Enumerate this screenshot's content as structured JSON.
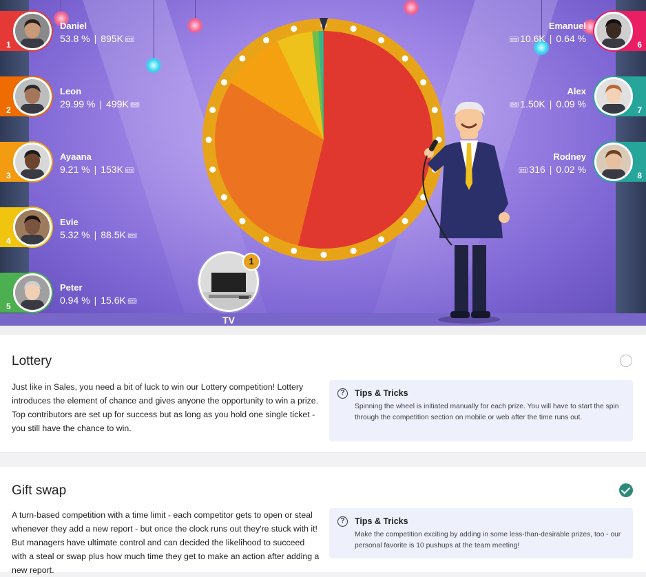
{
  "players_left": [
    {
      "rank": "1",
      "name": "Daniel",
      "percent": "53.8 %",
      "tickets": "895K",
      "color": "#e53935"
    },
    {
      "rank": "2",
      "name": "Leon",
      "percent": "29.99 %",
      "tickets": "499K",
      "color": "#ef6c00"
    },
    {
      "rank": "3",
      "name": "Ayaana",
      "percent": "9.21 %",
      "tickets": "153K",
      "color": "#f39c12"
    },
    {
      "rank": "4",
      "name": "Evie",
      "percent": "5.32 %",
      "tickets": "88.5K",
      "color": "#f1c40f"
    },
    {
      "rank": "5",
      "name": "Peter",
      "percent": "0.94 %",
      "tickets": "15.6K",
      "color": "#4caf50"
    }
  ],
  "players_right": [
    {
      "rank": "6",
      "name": "Emanuel",
      "percent": "0.64 %",
      "tickets": "10.6K",
      "color": "#e91e63"
    },
    {
      "rank": "7",
      "name": "Alex",
      "percent": "0.09 %",
      "tickets": "1.50K",
      "color": "#26a69a"
    },
    {
      "rank": "8",
      "name": "Rodney",
      "percent": "0.02 %",
      "tickets": "316",
      "color": "#26a69a"
    }
  ],
  "prize": {
    "label": "TV",
    "count": "1"
  },
  "wheel": {
    "slices": [
      {
        "name": "Daniel",
        "share": 53.8,
        "color": "#e0382f"
      },
      {
        "name": "Leon",
        "share": 29.99,
        "color": "#ec7420"
      },
      {
        "name": "Ayaana",
        "share": 9.21,
        "color": "#f5a010"
      },
      {
        "name": "Evie",
        "share": 5.32,
        "color": "#eec21a"
      },
      {
        "name": "Peter",
        "share": 0.94,
        "color": "#6cc04a"
      },
      {
        "name": "Emanuel",
        "share": 0.64,
        "color": "#36b58a"
      },
      {
        "name": "Alex",
        "share": 0.09,
        "color": "#2a9a8a"
      },
      {
        "name": "Rodney",
        "share": 0.02,
        "color": "#2a8a9a"
      }
    ],
    "rim_color": "#e8a418"
  },
  "ticket_icon": "ticket-icon",
  "sections": [
    {
      "title": "Lottery",
      "completed": false,
      "description": "Just like in Sales, you need a bit of luck to win our Lottery competition! Lottery introduces the element of chance and gives anyone the opportunity to win a prize. Top contributors are set up for success but as long as you hold one single ticket - you still have the chance to win.",
      "tips_title": "Tips & Tricks",
      "tips_body": "Spinning the wheel is initiated manually for each prize. You will have to start the spin through the competition section on mobile or web after the time runs out."
    },
    {
      "title": "Gift swap",
      "completed": true,
      "description": "A turn-based competition with a time limit - each competitor gets to open or steal whenever they add a new report - but once the clock runs out they're stuck with it! But managers have ultimate control and can decided the likelihood to succeed with a steal or swap plus how much time they get to make an action after adding a new report.",
      "tips_title": "Tips & Tricks",
      "tips_body": "Make the competition exciting by adding in some less-than-desirable prizes, too - our personal favorite is 10 pushups at the team meeting!"
    }
  ]
}
